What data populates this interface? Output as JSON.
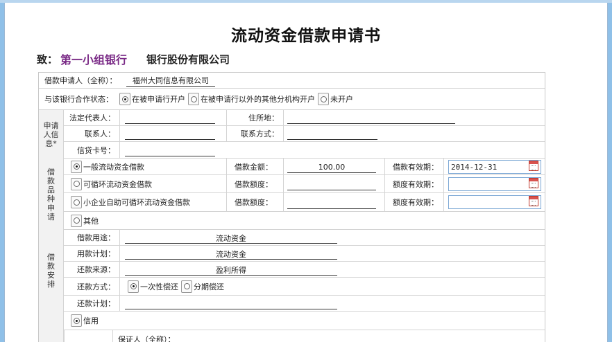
{
  "title": "流动资金借款申请书",
  "to_prefix": "致：",
  "bank_name": "第一小组银行",
  "bank_suffix": "银行股份有限公司",
  "applicant": {
    "label": "借款申请人（全称）：",
    "value": "福州大同信息有限公司"
  },
  "cooperation": {
    "label": "与该银行合作状态：",
    "options": [
      "在被申请行开户",
      "在被申请行以外的其他分机构开户",
      "未开户"
    ],
    "selected": 0
  },
  "applicant_info": {
    "section_label": "申请人信息*",
    "legal_rep_label": "法定代表人：",
    "address_label": "住所地：",
    "contact_label": "联系人：",
    "contact_method_label": "联系方式：",
    "loan_card_label": "信贷卡号："
  },
  "loan_type": {
    "section_label": "借款品种申请",
    "rows": [
      {
        "option": "一般流动资金借款",
        "selected": true,
        "amount_label": "借款金额：",
        "amount_value": "100.00",
        "period_label": "借款有效期：",
        "period_value": "2014-12-31"
      },
      {
        "option": "可循环流动资金借款",
        "selected": false,
        "amount_label": "借款额度：",
        "amount_value": "",
        "period_label": "额度有效期：",
        "period_value": ""
      },
      {
        "option": "小企业自助可循环流动资金借款",
        "selected": false,
        "amount_label": "借款额度：",
        "amount_value": "",
        "period_label": "额度有效期：",
        "period_value": ""
      }
    ],
    "other_option": "其他"
  },
  "arrangement": {
    "section_label": "借款安排",
    "purpose_label": "借款用途：",
    "purpose_value": "流动资金",
    "plan_label": "用款计划：",
    "plan_value": "流动资金",
    "source_label": "还款来源：",
    "source_value": "盈利所得",
    "method_label": "还款方式：",
    "method_options": [
      "一次性偿还",
      "分期偿还"
    ],
    "method_selected": 0,
    "repay_plan_label": "还款计划："
  },
  "guarantee": {
    "option": "信用",
    "selected": true,
    "guarantor_label": "保证人（全称）："
  }
}
